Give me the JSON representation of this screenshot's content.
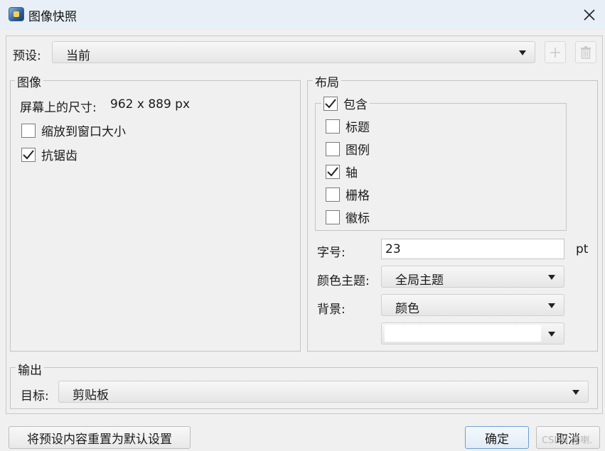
{
  "window": {
    "title": "图像快照"
  },
  "preset": {
    "label": "预设:",
    "selected": "当前",
    "add_icon": "plus-icon",
    "delete_icon": "trash-icon"
  },
  "image_group": {
    "title": "图像",
    "size_label": "屏幕上的尺寸:",
    "size_value": "962 x 889 px",
    "options": [
      {
        "label": "缩放到窗口大小",
        "checked": false
      },
      {
        "label": "抗锯齿",
        "checked": true
      }
    ]
  },
  "layout_group": {
    "title": "布局",
    "include": {
      "label": "包含",
      "checked": true
    },
    "items": [
      {
        "label": "标题",
        "checked": false
      },
      {
        "label": "图例",
        "checked": false
      },
      {
        "label": "轴",
        "checked": true
      },
      {
        "label": "栅格",
        "checked": false
      },
      {
        "label": "徽标",
        "checked": false
      }
    ],
    "font_size_label": "字号:",
    "font_size_value": "23",
    "font_size_unit": "pt",
    "theme_label": "颜色主题:",
    "theme_value": "全局主题",
    "background_label": "背景:",
    "background_value": "颜色",
    "background_color_value": "",
    "background_color": "#ffffff"
  },
  "output_group": {
    "title": "输出",
    "target_label": "目标:",
    "target_value": "剪贴板"
  },
  "footer": {
    "reset_label": "将预设内容重置为默认设置",
    "ok_label": "确定",
    "cancel_label": "取消",
    "watermark": "CSDN @喇."
  }
}
